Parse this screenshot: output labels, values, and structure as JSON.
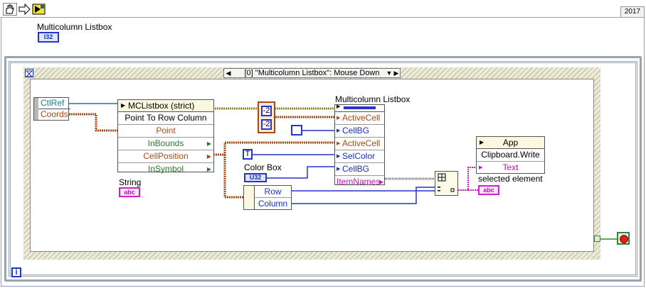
{
  "version": "2017",
  "control": {
    "label": "Multicolumn Listbox",
    "terminal": "I32"
  },
  "case_selector": {
    "label": "[0] \"Multicolumn Listbox\": Mouse Down"
  },
  "event_data": {
    "items": [
      "CtlRef",
      "Coords"
    ]
  },
  "invoke_node": {
    "title": "MCListbox (strict)",
    "method": "Point To Row Column",
    "inputs": [
      "Point"
    ],
    "outputs": [
      "InBounds",
      "CellPosition",
      "InSymbol"
    ]
  },
  "string_terminal": {
    "label": "String",
    "terminal": "abc"
  },
  "constants": {
    "neg2_a": "-2",
    "neg2_b": "-2",
    "t": "T"
  },
  "prop_node": {
    "label": "Multicolumn Listbox",
    "props": [
      "ActiveCell",
      "CellBG",
      "ActiveCell",
      "SelColor",
      "CellBG",
      "ItemNames"
    ]
  },
  "color_box": {
    "label": "Color Box",
    "terminal": "U32"
  },
  "unbundle": {
    "items": [
      "Row",
      "Column"
    ]
  },
  "app_node": {
    "title": "App",
    "method": "Clipboard.Write",
    "param": "Text"
  },
  "selected_indicator": {
    "label": "selected element",
    "terminal": "abc"
  },
  "icons": {
    "run": "hand-icon",
    "arrow": "arrow-icon",
    "vi": "vi-icon",
    "iteration": "i"
  },
  "colors": {
    "int_wire": "#2436c8",
    "cluster_wire": "#a84a14",
    "string_wire": "#d020c8",
    "ref_wire": "#1a7a8a"
  }
}
